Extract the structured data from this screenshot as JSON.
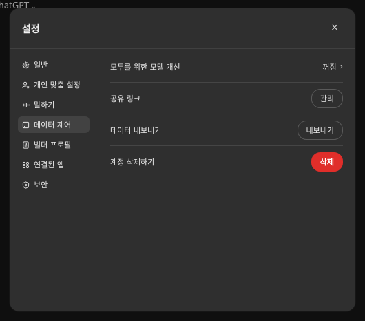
{
  "app": {
    "title": "hatGPT"
  },
  "modal": {
    "title": "설정",
    "close_label": "×"
  },
  "sidebar": {
    "items": [
      {
        "label": "일반",
        "icon": "gear-icon"
      },
      {
        "label": "개인 맞춤 설정",
        "icon": "personalization-icon"
      },
      {
        "label": "말하기",
        "icon": "voice-wave-icon"
      },
      {
        "label": "데이터 제어",
        "icon": "database-icon",
        "active": true
      },
      {
        "label": "빌더 프로필",
        "icon": "id-card-icon"
      },
      {
        "label": "연결된 앱",
        "icon": "apps-icon"
      },
      {
        "label": "보안",
        "icon": "shield-icon"
      }
    ]
  },
  "settings": {
    "model_improve": {
      "label": "모두를 위한 모델 개선",
      "value": "꺼짐"
    },
    "shared_links": {
      "label": "공유 링크",
      "button": "관리"
    },
    "export": {
      "label": "데이터 내보내기",
      "button": "내보내기"
    },
    "delete_account": {
      "label": "계정 삭제하기",
      "button": "삭제"
    }
  },
  "colors": {
    "danger": "#e02e2a",
    "modal_bg": "#2f2f2f",
    "page_bg": "#0f0f0f"
  }
}
